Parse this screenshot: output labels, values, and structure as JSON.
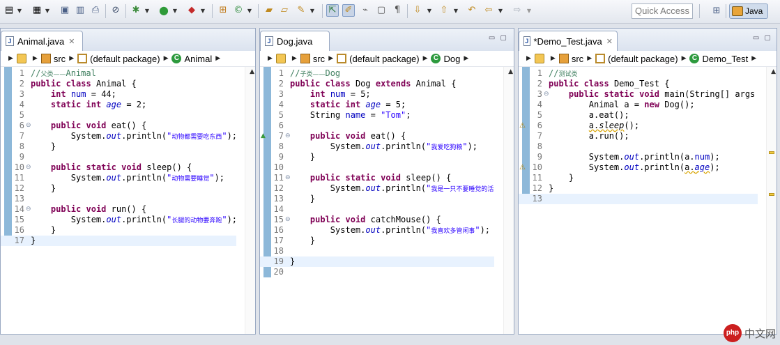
{
  "toolbar": {
    "quick_access_placeholder": "Quick Access",
    "perspective_label": "Java"
  },
  "panes": [
    {
      "tab_title": "Animal.java",
      "dirty": false,
      "breadcrumb": [
        "src",
        "(default package)",
        "Animal"
      ]
    },
    {
      "tab_title": "Dog.java",
      "dirty": false,
      "breadcrumb": [
        "src",
        "(default package)",
        "Dog"
      ]
    },
    {
      "tab_title": "*Demo_Test.java",
      "dirty": true,
      "breadcrumb": [
        "src",
        "(default package)",
        "Demo_Test"
      ]
    }
  ],
  "files": {
    "animal": [
      "//父类——Animal",
      "public class Animal {",
      "    int num = 44;",
      "    static int age = 2;",
      "",
      "    public void eat() {",
      "        System.out.println(\"动物都需要吃东西\");",
      "    }",
      "",
      "    public static void sleep() {",
      "        System.out.println(\"动物需要睡觉\");",
      "    }",
      "",
      "    public void run() {",
      "        System.out.println(\"长腿的动物要奔跑\");",
      "    }",
      "}"
    ],
    "dog": [
      "//子类——Dog",
      "public class Dog extends Animal {",
      "    int num = 5;",
      "    static int age = 5;",
      "    String name = \"Tom\";",
      "",
      "    public void eat() {",
      "        System.out.println(\"我爱吃狗粮\");",
      "    }",
      "",
      "    public static void sleep() {",
      "        System.out.println(\"我是一只不要睡觉的活泼",
      "    }",
      "",
      "    public void catchMouse() {",
      "        System.out.println(\"我喜欢多管闲事\");",
      "    }",
      "",
      "}",
      ""
    ],
    "demo": [
      "//测试类",
      "public class Demo_Test {",
      "    public static void main(String[] args",
      "        Animal a = new Dog();",
      "        a.eat();",
      "        a.sleep();",
      "        a.run();",
      "",
      "        System.out.println(a.num);",
      "        System.out.println(a.age);",
      "    }",
      "}",
      ""
    ]
  },
  "watermark": {
    "logo_text": "php",
    "site_text": "中文网"
  },
  "colors": {
    "keyword": "#7f0055",
    "comment": "#3f7f5f",
    "field": "#0000c0",
    "string": "#2a00ff",
    "current_line": "#e8f2fe"
  }
}
